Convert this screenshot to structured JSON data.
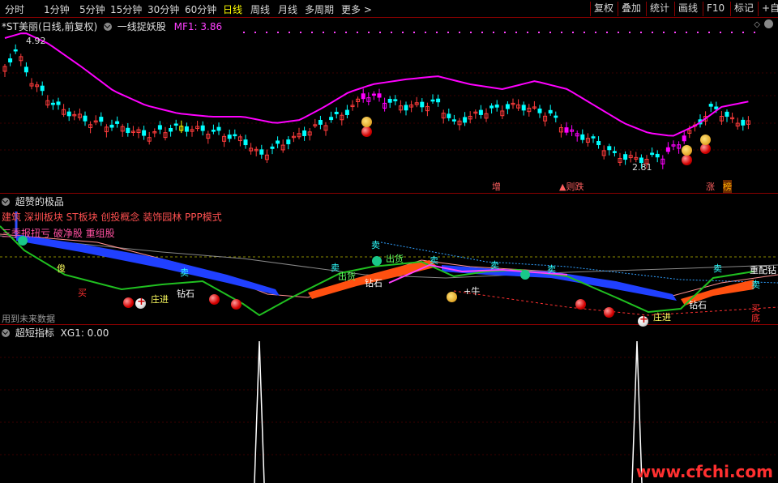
{
  "toolbar": {
    "tabs": [
      "分时",
      "1分钟",
      "5分钟",
      "15分钟",
      "30分钟",
      "60分钟",
      "日线",
      "周线",
      "月线",
      "多周期",
      "更多"
    ],
    "active_tab": "日线",
    "buttons": [
      "复权",
      "叠加",
      "统计",
      "画线",
      "F10",
      "标记",
      "+自选"
    ]
  },
  "panel1": {
    "stock": "*ST美丽(日线,前复权)",
    "indicator": "一线捉妖股",
    "mf_label": "MF1: 3.86",
    "high_label": "4.92",
    "low_label": "2.81",
    "tags": [
      "增",
      "▲则跌",
      "涨",
      "榜"
    ]
  },
  "panel2": {
    "title": "超赞的极品",
    "line1": "建筑 深圳板块 ST板块 创投概念 装饰园林 PPP模式",
    "line2": "三季报扭亏 破净股 重组股",
    "bottom_note": "用到未来数据",
    "signals": {
      "buy": "买",
      "zhuang": "庄进",
      "stone": "钻石",
      "chu": "出货",
      "sell": "卖",
      "jun": "俊",
      "niu": "+牛",
      "chong": "重配钻",
      "di": "底"
    }
  },
  "panel3": {
    "title": "超短指标",
    "xg_label": "XG1: 0.00"
  },
  "watermark": "www.cfchi.com",
  "colors": {
    "up": "#ff3c3c",
    "down": "#00ffff",
    "ma": "#ff00ff",
    "bg": "#000000",
    "border": "#8a0000"
  }
}
